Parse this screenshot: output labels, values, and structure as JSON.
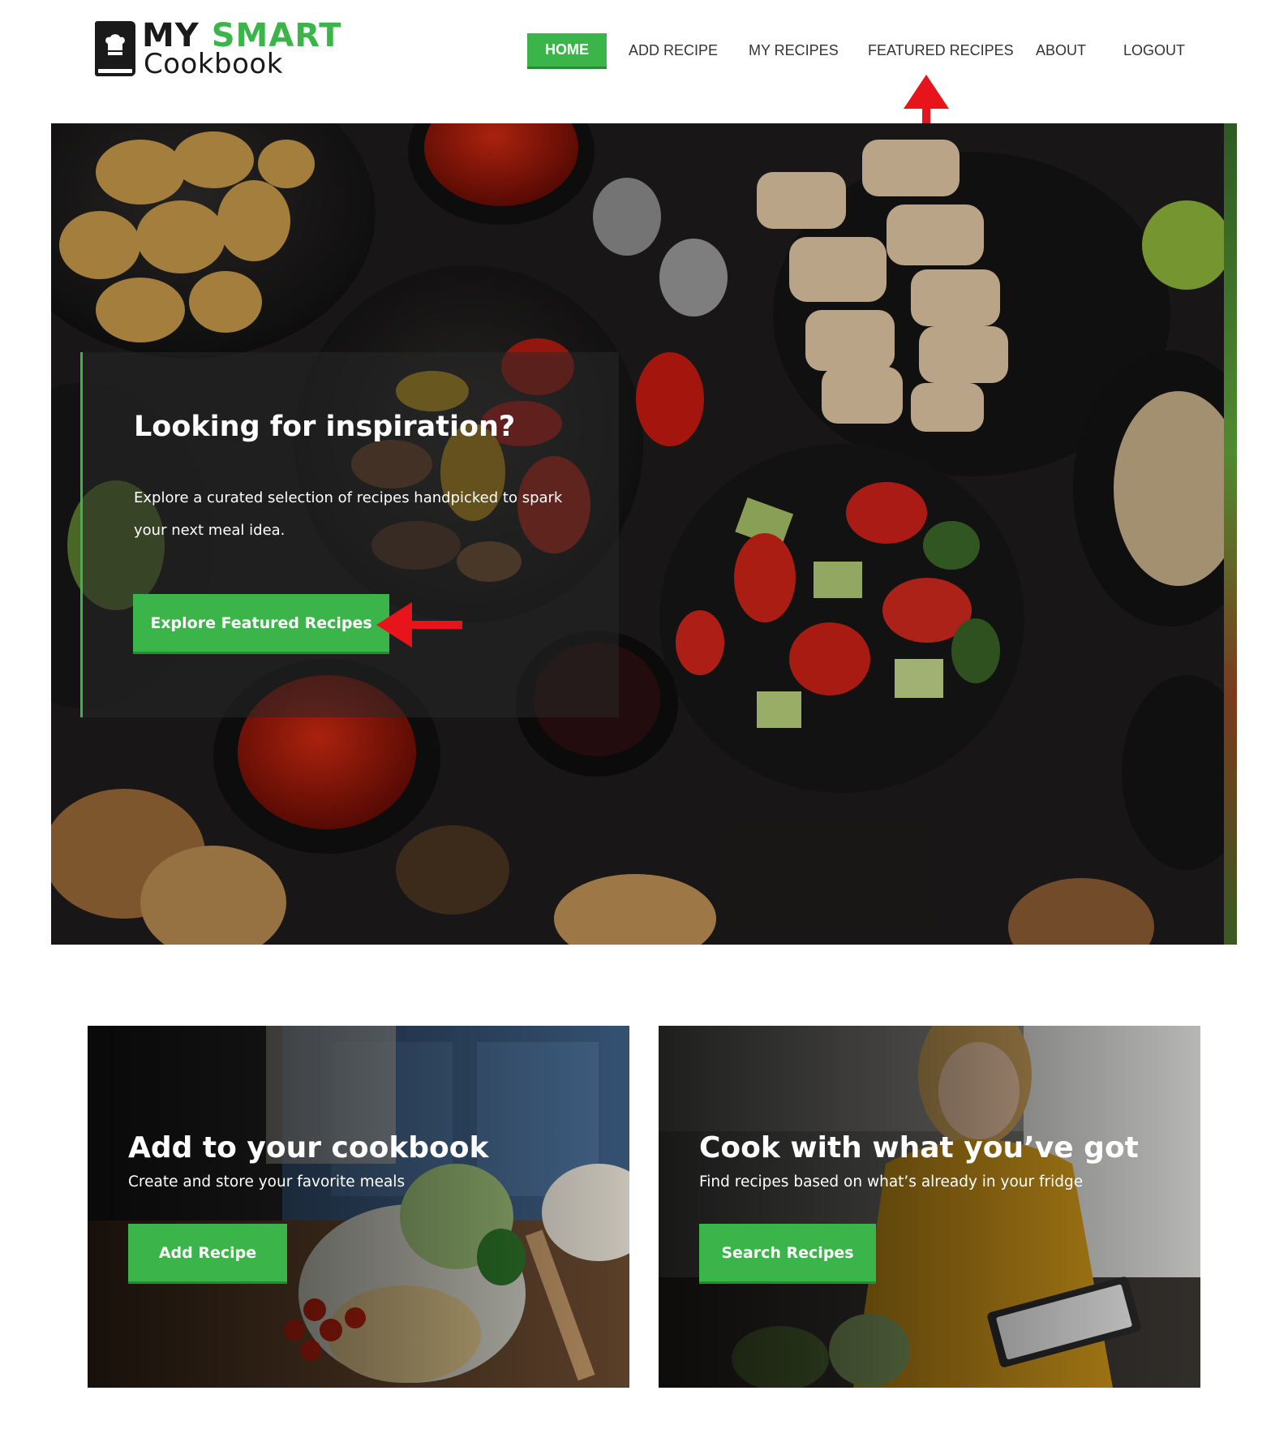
{
  "brand": {
    "line1_a": "MY",
    "line1_b": "SMART",
    "line2": "Cookbook"
  },
  "nav": {
    "home": "HOME",
    "add_recipe": "ADD RECIPE",
    "my_recipes": "MY RECIPES",
    "featured_recipes": "FEATURED RECIPES",
    "about": "ABOUT",
    "logout": "LOGOUT",
    "active": "home"
  },
  "hero": {
    "title": "Looking for inspiration?",
    "description": "Explore a curated selection of recipes handpicked to spark your next meal idea.",
    "button_label": "Explore Featured Recipes"
  },
  "cards": {
    "add": {
      "title": "Add to your cookbook",
      "subtitle": "Create and store your favorite meals",
      "button_label": "Add Recipe"
    },
    "search": {
      "title": "Cook with what you’ve got",
      "subtitle": "Find recipes based on what’s already in your fridge",
      "button_label": "Search Recipes"
    }
  },
  "colors": {
    "accent_green": "#3bb54a",
    "annotation_red": "#e8141b",
    "text_dark": "#333333"
  },
  "icons": {
    "logo": "chef-hat-book-icon",
    "annotation_up": "red-arrow-up-icon",
    "annotation_left": "red-arrow-left-icon"
  }
}
